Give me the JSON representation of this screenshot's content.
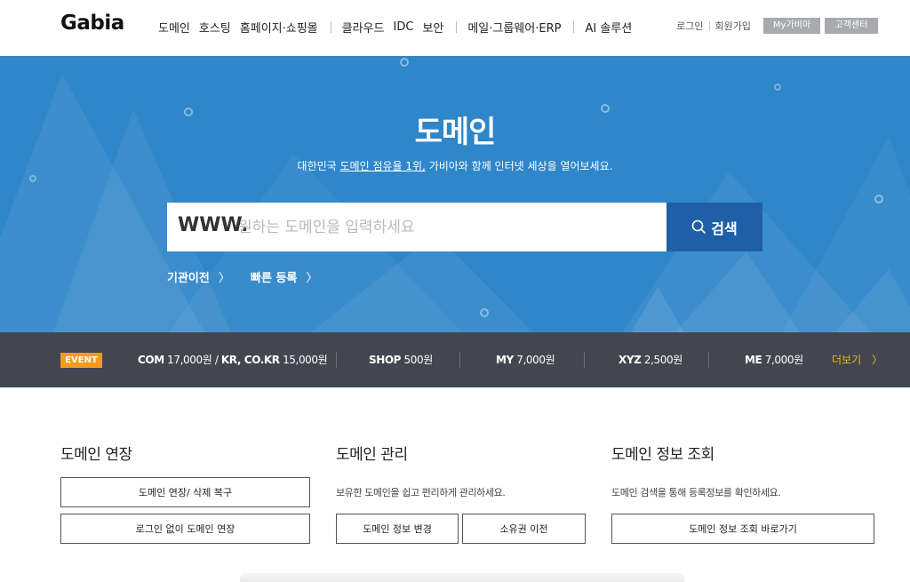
{
  "header": {
    "logo": "Gabia",
    "nav": [
      "도메인",
      "호스팅",
      "홈페이지·쇼핑몰",
      "클라우드",
      "IDC",
      "보안",
      "메일·그룹웨어·ERP",
      "AI 솔루션"
    ],
    "login": "로그인",
    "signup": "회원가입",
    "my_gabia": "My가비아",
    "customer_center": "고객센터"
  },
  "hero": {
    "title": "도메인",
    "subtitle_pre": "대한민국 ",
    "subtitle_link": "도메인 점유율 1위,",
    "subtitle_post": " 가비아와 함께 인터넷 세상을 열어보세요.",
    "search_prefix": "WWW.",
    "search_placeholder": "원하는 도메인을 입력하세요",
    "search_button": "검색",
    "quick_links": [
      "기관이전",
      "빠른 등록"
    ],
    "bg_color": "#2f86c9",
    "button_color": "#1f5fa8"
  },
  "event_bar": {
    "badge": "EVENT",
    "items": [
      {
        "tld": "COM",
        "price": "17,000원",
        "sep": " / ",
        "tld2": "KR, CO.KR",
        "price2": "15,000원"
      },
      {
        "tld": "SHOP",
        "price": "500원"
      },
      {
        "tld": "MY",
        "price": "7,000원"
      },
      {
        "tld": "XYZ",
        "price": "2,500원"
      },
      {
        "tld": "ME",
        "price": "7,000원"
      }
    ],
    "more": "더보기",
    "badge_color": "#f29c1f",
    "more_color": "#f2b12e"
  },
  "sections": {
    "renew": {
      "title": "도메인 연장",
      "buttons": [
        "도메인 연장/ 삭제 복구",
        "로그인 없이 도메인 연장"
      ]
    },
    "manage": {
      "title": "도메인 관리",
      "desc": "보유한 도메인을 쉽고 편리하게 관리하세요.",
      "buttons": [
        "도메인 정보 변경",
        "소유권 이전"
      ]
    },
    "whois": {
      "title": "도메인 정보 조회",
      "desc": "도메인 검색을 통해 등록정보를 확인하세요.",
      "buttons": [
        "도메인 정보 조회 바로가기"
      ]
    }
  }
}
